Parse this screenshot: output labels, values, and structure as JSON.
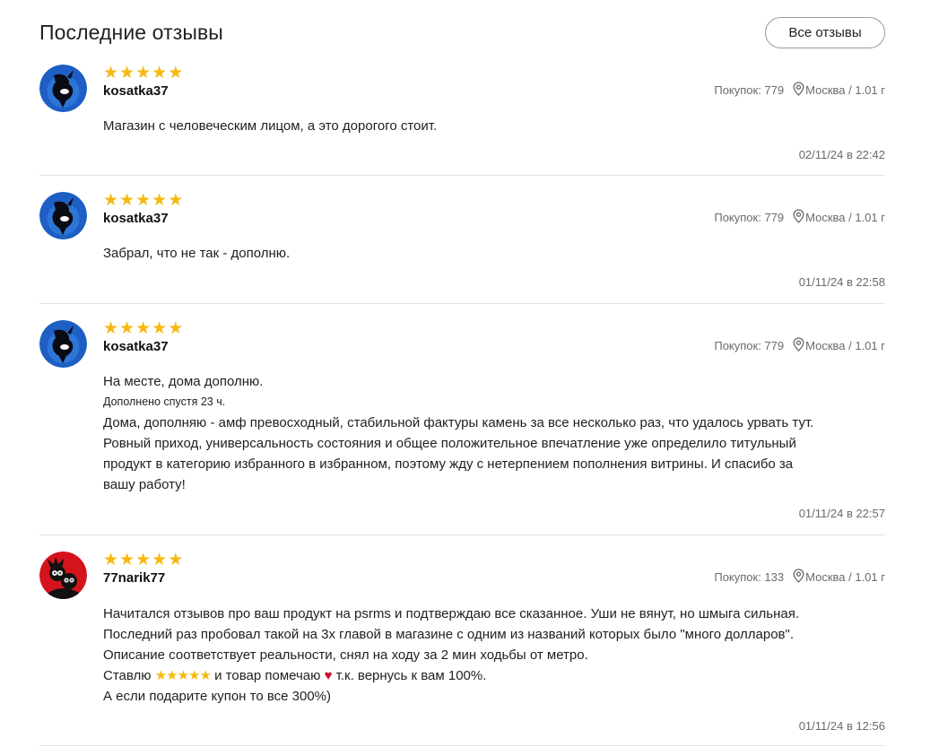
{
  "header": {
    "title": "Последние отзывы",
    "all_reviews_label": "Все отзывы"
  },
  "colors": {
    "star": "#f5b90f",
    "divider": "#e2e2e2",
    "meta_text": "#6b6b6b"
  },
  "reviews": [
    {
      "avatar": "orca-avatar",
      "rating": 5,
      "username": "kosatka37",
      "purchases_label": "Покупок: 779",
      "location": "Москва / 1.01 г",
      "text": "Магазин с человеческим лицом, а это дорогого стоит.",
      "date": "02/11/24 в 22:42"
    },
    {
      "avatar": "orca-avatar",
      "rating": 5,
      "username": "kosatka37",
      "purchases_label": "Покупок: 779",
      "location": "Москва / 1.01 г",
      "text": "Забрал, что не так - дополню.",
      "date": "01/11/24 в 22:58"
    },
    {
      "avatar": "orca-avatar",
      "rating": 5,
      "username": "kosatka37",
      "purchases_label": "Покупок: 779",
      "location": "Москва / 1.01 г",
      "text": "На месте, дома дополню.",
      "addendum_label": "Дополнено спустя 23 ч.",
      "addendum_lines": [
        "Дома, дополняю - амф превосходный, стабильной фактуры камень за все несколько раз, что удалось урвать тут.",
        "Ровный приход, универсальность состояния и общее положительное впечатление уже определило титульный",
        "продукт в категорию избранного в избранном, поэтому жду с нетерпением пополнения витрины. И спасибо за",
        "вашу работу!"
      ],
      "date": "01/11/24 в 22:57"
    },
    {
      "avatar": "cartoon-avatar",
      "rating": 5,
      "username": "77narik77",
      "purchases_label": "Покупок: 133",
      "location": "Москва / 1.01 г",
      "lines": [
        "Начитался отзывов про ваш продукт на psrms и подтверждаю все сказанное. Уши не вянут, но шмыга сильная.",
        "Последний раз пробовал такой на 3х главой в магазине с одним из названий которых было \"много долларов\".",
        "Описание соответствует реальности, снял на ходу за 2 мин ходьбы от метро."
      ],
      "line_stars_before": "Ставлю",
      "inline_stars": "★★★★★",
      "line_stars_middle": "и товар помечаю",
      "heart": "♥",
      "line_stars_after": "т.к. вернусь к вам 100%.",
      "last_line": "А если подарите купон то все 300%)",
      "date": "01/11/24 в 12:56"
    }
  ]
}
